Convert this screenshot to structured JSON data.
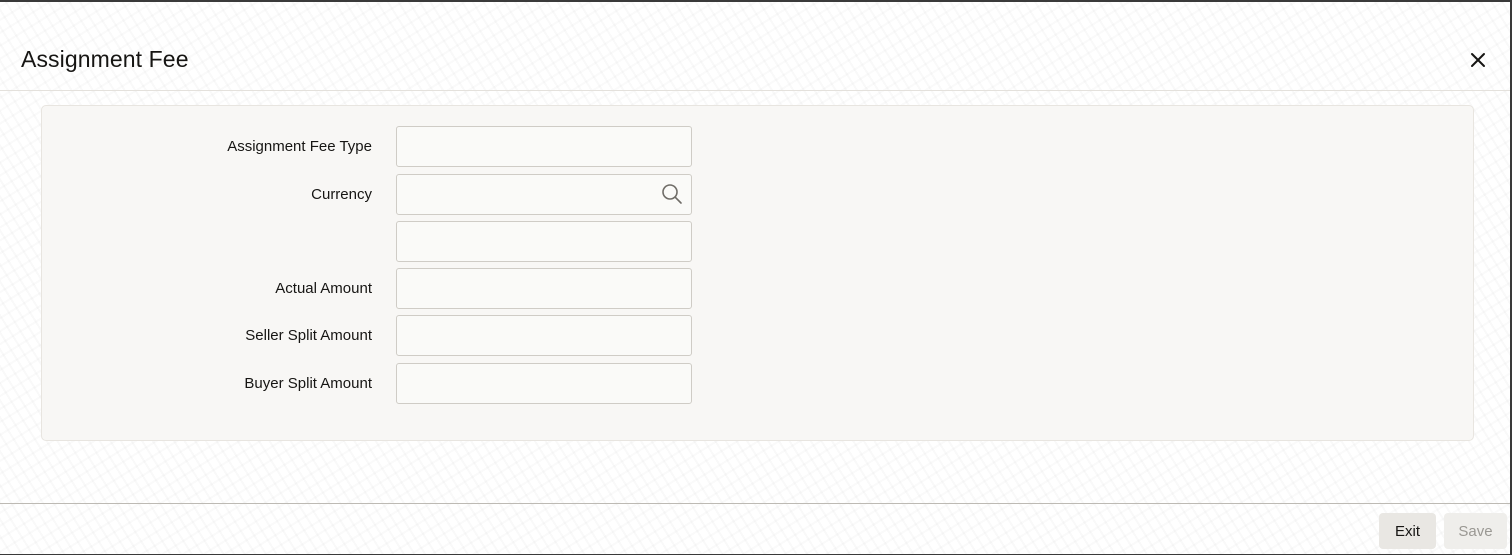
{
  "dialog": {
    "title": "Assignment Fee",
    "close_icon": "close-icon"
  },
  "form": {
    "fields": [
      {
        "label": "Assignment Fee Type",
        "value": "",
        "has_search": false
      },
      {
        "label": "Currency",
        "value": "",
        "has_search": true,
        "search_icon": "search-icon"
      },
      {
        "label": "",
        "value": "",
        "has_search": false
      },
      {
        "label": "Actual Amount",
        "value": "",
        "has_search": false
      },
      {
        "label": "Seller Split Amount",
        "value": "",
        "has_search": false
      },
      {
        "label": "Buyer Split Amount",
        "value": "",
        "has_search": false
      }
    ]
  },
  "footer": {
    "exit_label": "Exit",
    "save_label": "Save",
    "save_enabled": false
  },
  "colors": {
    "text": "#161513",
    "panel_bg": "#f8f7f5",
    "disabled_text": "#9a9893"
  }
}
